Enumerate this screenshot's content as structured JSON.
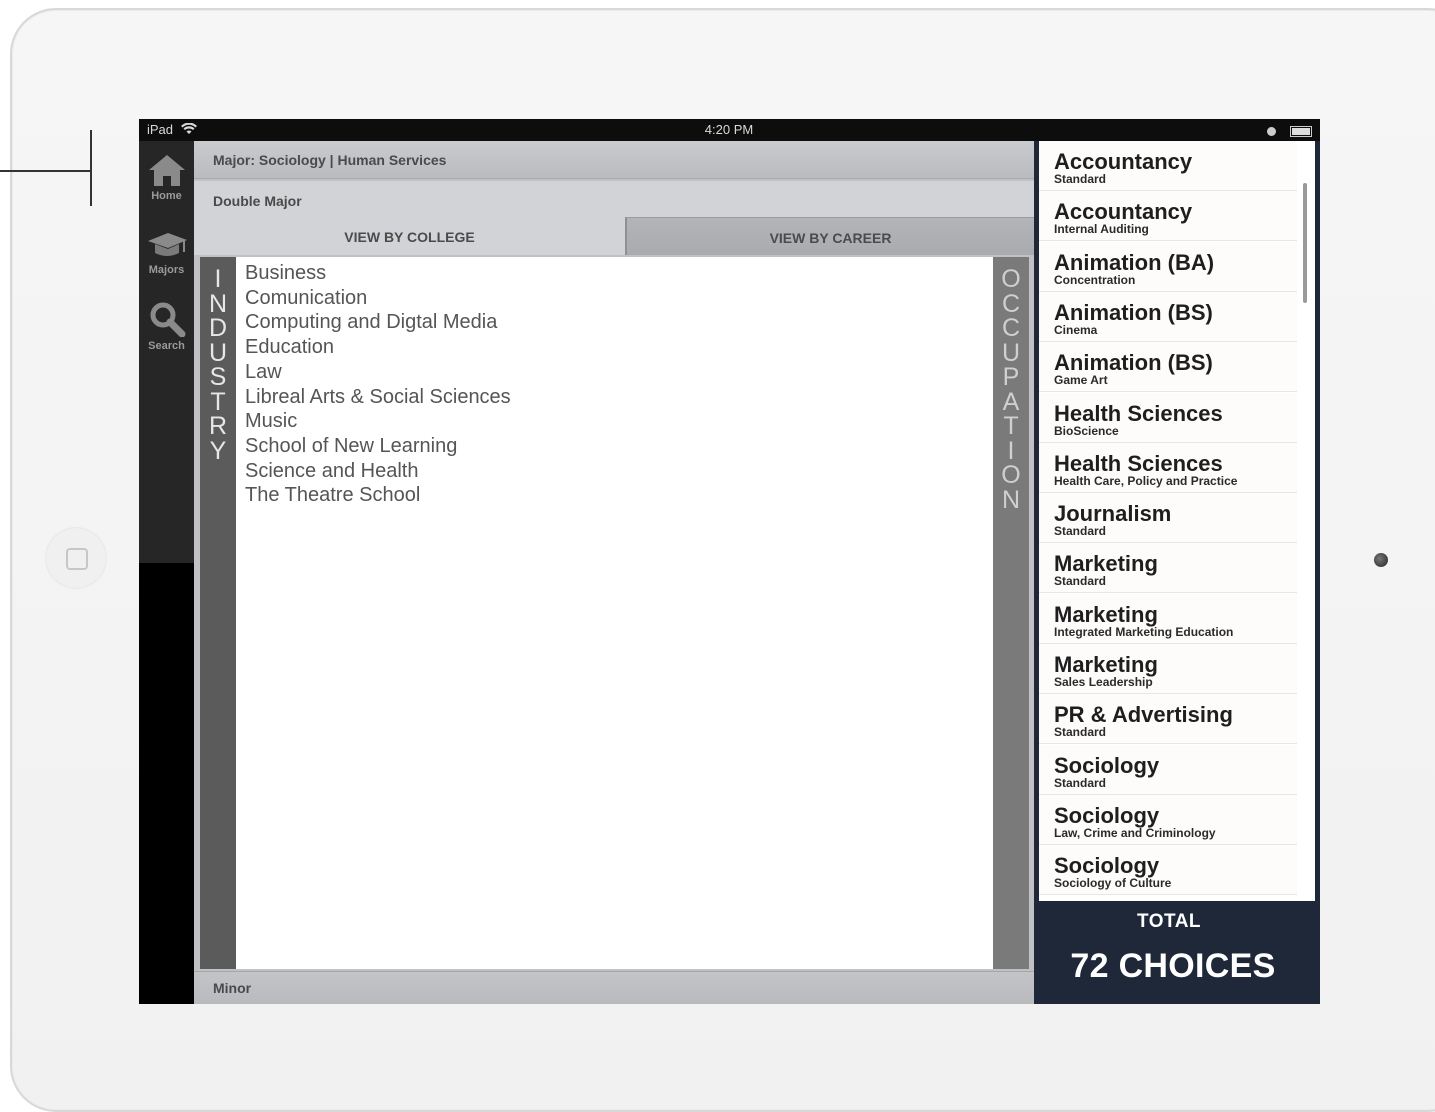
{
  "status_bar": {
    "device": "iPad",
    "time": "4:20 PM"
  },
  "sidebar": {
    "items": [
      {
        "label": "Home",
        "icon": "home-icon"
      },
      {
        "label": "Majors",
        "icon": "graduation-cap-icon"
      },
      {
        "label": "Search",
        "icon": "search-icon"
      }
    ]
  },
  "header": {
    "major": "Major: Sociology | Human Services",
    "double_major": "Double Major",
    "minor": "Minor"
  },
  "tabs": [
    {
      "label": "VIEW BY COLLEGE",
      "active": true
    },
    {
      "label": "VIEW BY CAREER",
      "active": false
    }
  ],
  "side_labels": {
    "left": "INDUSTRY",
    "right": "OCCUPATION"
  },
  "colleges": [
    "Business",
    "Comunication",
    "Computing and Digtal Media",
    "Education",
    "Law",
    "Libreal Arts & Social Sciences",
    "Music",
    "School of New Learning",
    "Science and Health",
    "The Theatre School"
  ],
  "majors": [
    {
      "name": "Accountancy",
      "sub": "Standard"
    },
    {
      "name": "Accountancy",
      "sub": "Internal Auditing"
    },
    {
      "name": "Animation (BA)",
      "sub": "Concentration"
    },
    {
      "name": "Animation (BS)",
      "sub": "Cinema"
    },
    {
      "name": "Animation (BS)",
      "sub": "Game Art"
    },
    {
      "name": "Health Sciences",
      "sub": "BioScience"
    },
    {
      "name": "Health Sciences",
      "sub": "Health Care, Policy and Practice"
    },
    {
      "name": "Journalism",
      "sub": "Standard"
    },
    {
      "name": "Marketing",
      "sub": "Standard"
    },
    {
      "name": "Marketing",
      "sub": "Integrated Marketing Education"
    },
    {
      "name": "Marketing",
      "sub": "Sales Leadership"
    },
    {
      "name": "PR & Advertising",
      "sub": "Standard"
    },
    {
      "name": "Sociology",
      "sub": "Standard"
    },
    {
      "name": "Sociology",
      "sub": "Law, Crime and Criminology"
    },
    {
      "name": "Sociology",
      "sub": "Sociology of Culture"
    }
  ],
  "total": {
    "label": "TOTAL",
    "value": "72 CHOICES"
  },
  "colors": {
    "total_panel": "#1e2838",
    "industry_bar": "#5b5b5b",
    "occupation_bar": "#7a7a7a"
  }
}
